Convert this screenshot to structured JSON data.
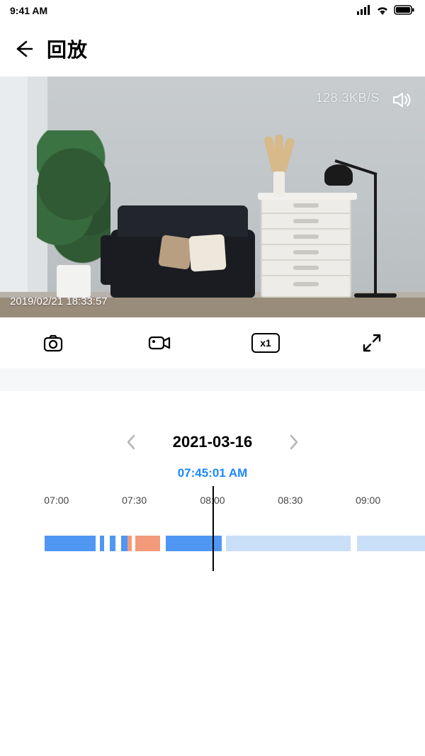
{
  "status": {
    "time": "9:41 AM"
  },
  "nav": {
    "title": "回放"
  },
  "video": {
    "bitrate": "128.3KB/S",
    "timestamp": "2019/02/21  18:33:57"
  },
  "toolbar": {
    "speed_label": "x1"
  },
  "date_picker": {
    "date": "2021-03-16"
  },
  "playhead": {
    "time": "07:45:01 AM"
  },
  "timeline": {
    "ticks": [
      "07:00",
      "07:30",
      "08:00",
      "08:30",
      "09:00"
    ],
    "tick_positions_pct": [
      13.3,
      31.6,
      50,
      68.3,
      86.6
    ],
    "playhead_pct": 50,
    "segments": [
      {
        "start_pct": 10.5,
        "end_pct": 22.5,
        "type": "blue"
      },
      {
        "start_pct": 23.5,
        "end_pct": 24.5,
        "type": "blue"
      },
      {
        "start_pct": 25.8,
        "end_pct": 27.2,
        "type": "blue"
      },
      {
        "start_pct": 28.5,
        "end_pct": 30.0,
        "type": "blue"
      },
      {
        "start_pct": 30.0,
        "end_pct": 31.0,
        "type": "orange"
      },
      {
        "start_pct": 31.8,
        "end_pct": 37.6,
        "type": "orange"
      },
      {
        "start_pct": 39.0,
        "end_pct": 52.2,
        "type": "blue"
      },
      {
        "start_pct": 53.2,
        "end_pct": 82.5,
        "type": "light"
      },
      {
        "start_pct": 84.0,
        "end_pct": 100.0,
        "type": "light"
      }
    ]
  }
}
